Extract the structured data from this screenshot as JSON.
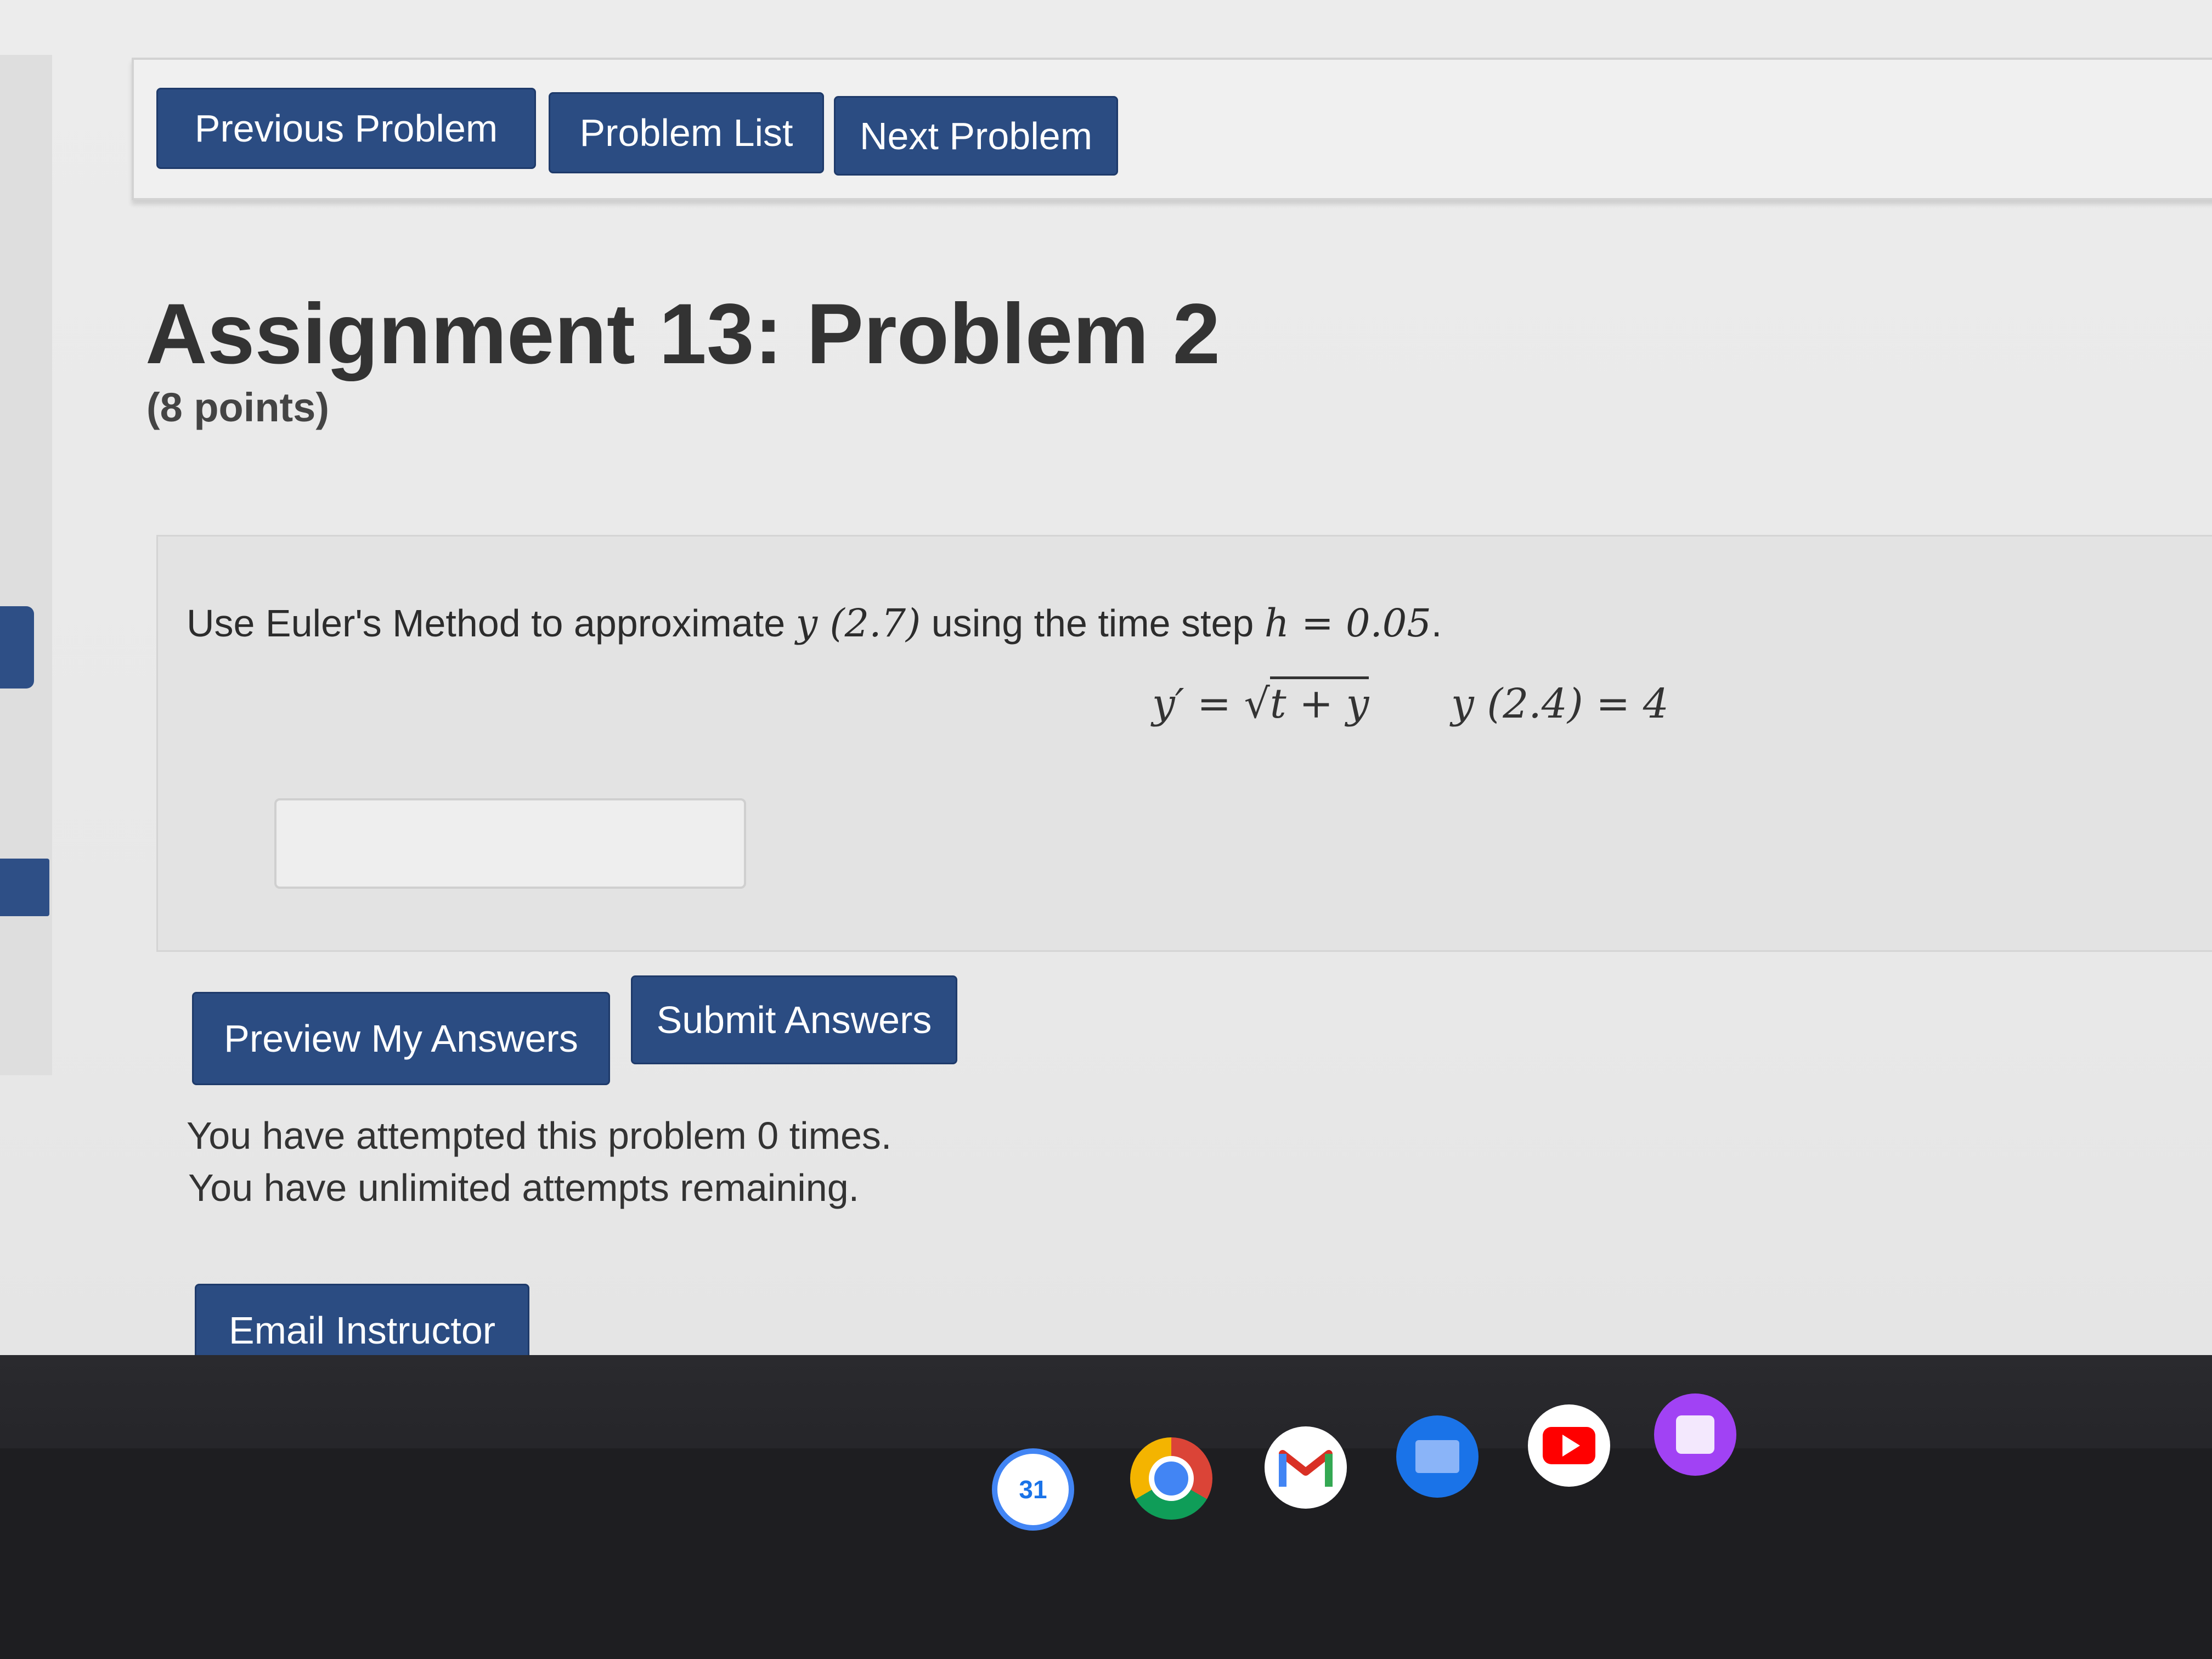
{
  "nav": {
    "previous_label": "Previous Problem",
    "list_label": "Problem List",
    "next_label": "Next Problem"
  },
  "header": {
    "title": "Assignment 13: Problem 2",
    "points": "(8 points)"
  },
  "problem": {
    "intro": "Use Euler's Method to approximate ",
    "target": "y (2.7)",
    "mid": " using the time step ",
    "step": "h = 0.05",
    "end": ".",
    "ode_lhs": "y′ = ",
    "ode_radicand": "t + y",
    "initial_condition": "y (2.4) = 4",
    "answer_value": ""
  },
  "actions": {
    "preview_label": "Preview My Answers",
    "submit_label": "Submit Answers",
    "email_label": "Email Instructor"
  },
  "status": {
    "attempts": "You have attempted this problem 0 times.",
    "remaining": "You have unlimited attempts remaining."
  },
  "shelf": {
    "calendar_day": "31",
    "icons": [
      "calendar-icon",
      "chrome-icon",
      "gmail-icon",
      "files-icon",
      "youtube-icon",
      "gallery-icon"
    ]
  },
  "colors": {
    "button": "#2b4c82",
    "background": "#ececec",
    "text": "#333333"
  }
}
